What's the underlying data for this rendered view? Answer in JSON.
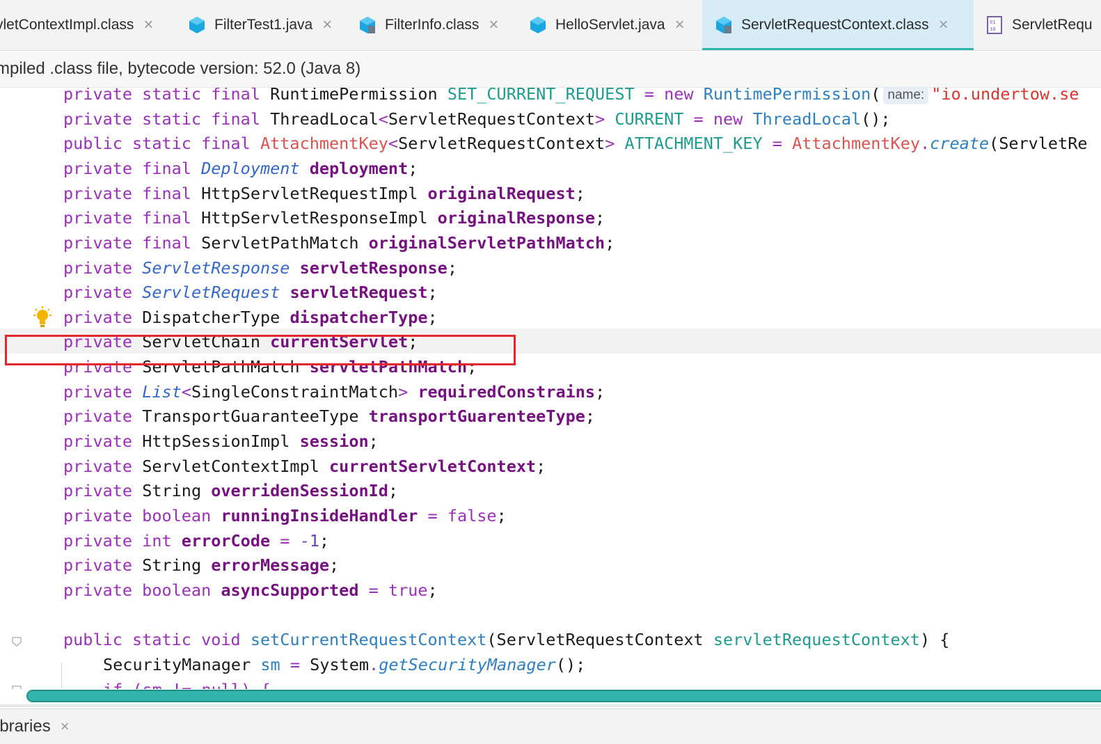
{
  "tabs": [
    {
      "label": "vletContextImpl.class",
      "icon": "none",
      "active": false
    },
    {
      "label": "FilterTest1.java",
      "icon": "java-class-icon",
      "active": false
    },
    {
      "label": "FilterInfo.class",
      "icon": "class-file-icon",
      "active": false
    },
    {
      "label": "HelloServlet.java",
      "icon": "java-class-icon",
      "active": false
    },
    {
      "label": "ServletRequestContext.class",
      "icon": "class-file-icon",
      "active": true
    },
    {
      "label": "ServletRequ",
      "icon": "binary-file-icon",
      "active": false
    }
  ],
  "tab_close_glyph": "×",
  "info_bar": "mpiled .class file, bytecode version: 52.0 (Java 8)",
  "param_hint": "name:",
  "code": {
    "l1": {
      "kw": "private static final",
      "type": "RuntimePermission",
      "const": "SET_CURRENT_REQUEST",
      "op": "=",
      "new": "new",
      "ctor": "RuntimePermission",
      "paren": "(",
      "str": "\"io.undertow.se"
    },
    "l2": {
      "kw": "private static final",
      "type": "ThreadLocal",
      "lt": "<",
      "generic": "ServletRequestContext",
      "gt": ">",
      "const": "CURRENT",
      "op": "=",
      "new": "new",
      "ctor": "ThreadLocal",
      "tail": "();"
    },
    "l3": {
      "kw": "public static final",
      "cls": "AttachmentKey",
      "lt": "<",
      "generic": "ServletRequestContext",
      "gt": ">",
      "const": "ATTACHMENT_KEY",
      "op": "=",
      "cls2": "AttachmentKey",
      "dot": ".",
      "method": "create",
      "tail": "(ServletRe"
    },
    "l4": {
      "kw": "private final",
      "itype": "Deployment",
      "field": "deployment"
    },
    "l5": {
      "kw": "private final",
      "type": "HttpServletRequestImpl",
      "field": "originalRequest"
    },
    "l6": {
      "kw": "private final",
      "type": "HttpServletResponseImpl",
      "field": "originalResponse"
    },
    "l7": {
      "kw": "private final",
      "type": "ServletPathMatch",
      "field": "originalServletPathMatch"
    },
    "l8": {
      "kw": "private",
      "itype": "ServletResponse",
      "field": "servletResponse"
    },
    "l9": {
      "kw": "private",
      "itype": "ServletRequest",
      "field": "servletRequest"
    },
    "l10": {
      "kw": "private",
      "type": "DispatcherType",
      "field": "dispatcherType"
    },
    "l11": {
      "kw": "private",
      "type": "ServletChain",
      "field": "currentServlet"
    },
    "l12": {
      "kw": "private",
      "type": "ServletPathMatch",
      "field": "servletPathMatch"
    },
    "l13": {
      "kw": "private",
      "itype": "List",
      "lt": "<",
      "generic": "SingleConstraintMatch",
      "gt": ">",
      "field": "requiredConstrains"
    },
    "l14": {
      "kw": "private",
      "type": "TransportGuaranteeType",
      "field": "transportGuarenteeType"
    },
    "l15": {
      "kw": "private",
      "type": "HttpSessionImpl",
      "field": "session"
    },
    "l16": {
      "kw": "private",
      "type": "ServletContextImpl",
      "field": "currentServletContext"
    },
    "l17": {
      "kw": "private",
      "type": "String",
      "field": "overridenSessionId"
    },
    "l18": {
      "kw": "private boolean",
      "field": "runningInsideHandler",
      "op": "=",
      "val": "false"
    },
    "l19": {
      "kw": "private int",
      "field": "errorCode",
      "op": "=",
      "val": "-1"
    },
    "l20": {
      "kw": "private",
      "type": "String",
      "field": "errorMessage"
    },
    "l21": {
      "kw": "private boolean",
      "field": "asyncSupported",
      "op": "=",
      "val": "true"
    },
    "l22": {
      "kw": "public static void",
      "method": "setCurrentRequestContext",
      "open": "(",
      "ptype": "ServletRequestContext",
      "param": "servletRequestContext",
      "close": ") {"
    },
    "l23": {
      "type": "SecurityManager",
      "var": "sm",
      "op": "=",
      "cls": "System",
      "dot": ".",
      "method": "getSecurityManager",
      "tail": "();"
    },
    "l24": {
      "text": "if (sm != null) {"
    }
  },
  "semicolon": ";",
  "bottom_tab": {
    "label": "ibraries",
    "close": "×"
  },
  "colors": {
    "accent": "#2db3a9",
    "highlight_box": "#e5262d",
    "keyword": "#9b30b8",
    "field": "#75127f"
  }
}
